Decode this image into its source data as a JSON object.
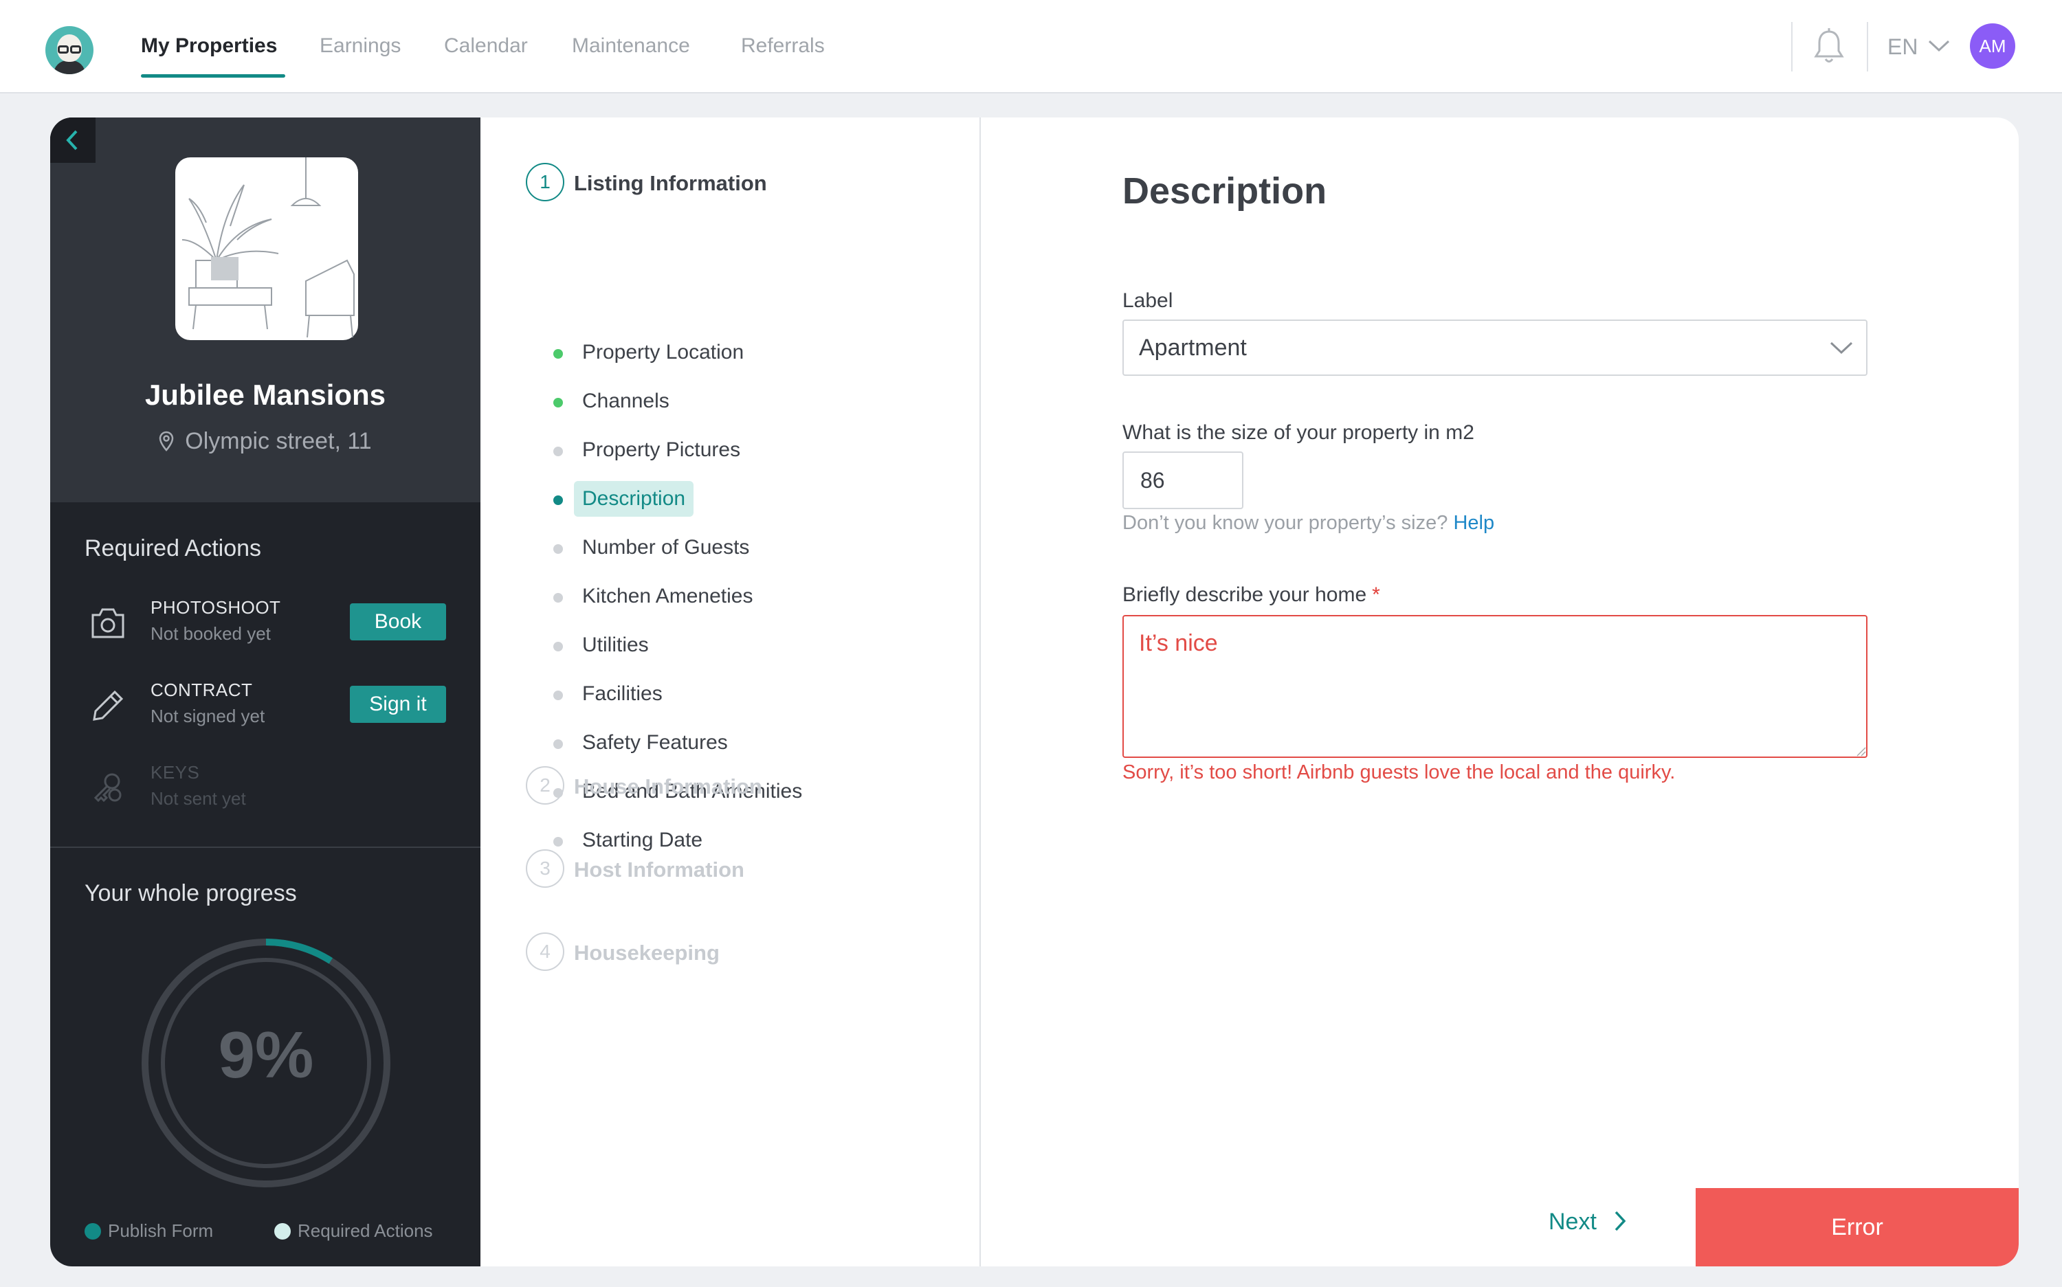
{
  "nav": {
    "items": [
      "My Properties",
      "Earnings",
      "Calendar",
      "Maintenance",
      "Referrals"
    ],
    "language": "EN",
    "avatar_initials": "AM",
    "accent_color": "#128a86"
  },
  "property": {
    "name": "Jubilee Mansions",
    "address": "Olympic street, 11"
  },
  "required_actions": {
    "title": "Required Actions",
    "items": [
      {
        "icon": "camera-icon",
        "title": "PHOTOSHOOT",
        "status": "Not booked yet",
        "button": "Book"
      },
      {
        "icon": "pencil-icon",
        "title": "CONTRACT",
        "status": "Not signed yet",
        "button": "Sign it"
      },
      {
        "icon": "keys-icon",
        "title": "KEYS",
        "status": "Not sent yet"
      }
    ]
  },
  "progress": {
    "title": "Your whole progress",
    "percent_label": "9%",
    "value": 0.09,
    "legend": [
      "Publish Form",
      "Required Actions"
    ]
  },
  "steps": [
    {
      "num": "1",
      "title": "Listing Information"
    },
    {
      "num": "2",
      "title": "House Information"
    },
    {
      "num": "3",
      "title": "Host Information"
    },
    {
      "num": "4",
      "title": "Housekeeping"
    }
  ],
  "substeps": [
    {
      "label": "Property Location",
      "state": "done"
    },
    {
      "label": "Channels",
      "state": "done"
    },
    {
      "label": "Property Pictures",
      "state": "todo"
    },
    {
      "label": "Description",
      "state": "current"
    },
    {
      "label": "Number of Guests",
      "state": "todo"
    },
    {
      "label": "Kitchen Ameneties",
      "state": "todo"
    },
    {
      "label": "Utilities",
      "state": "todo"
    },
    {
      "label": "Facilities",
      "state": "todo"
    },
    {
      "label": "Safety Features",
      "state": "todo"
    },
    {
      "label": "Bed and Bath Amenities",
      "state": "todo"
    },
    {
      "label": "Starting Date",
      "state": "todo"
    }
  ],
  "form": {
    "heading": "Description",
    "label_field": {
      "label": "Label",
      "value": "Apartment"
    },
    "size_field": {
      "label": "What is the size of your property in m2",
      "value": "86",
      "hint": "Don’t you know your property’s size?",
      "help_link": "Help"
    },
    "describe_field": {
      "label": "Briefly describe your home",
      "required_mark": "*",
      "value": "It’s nice",
      "error": "Sorry, it’s too short! Airbnb guests love the local and the quirky."
    },
    "next_label": "Next",
    "error_label": "Error"
  }
}
